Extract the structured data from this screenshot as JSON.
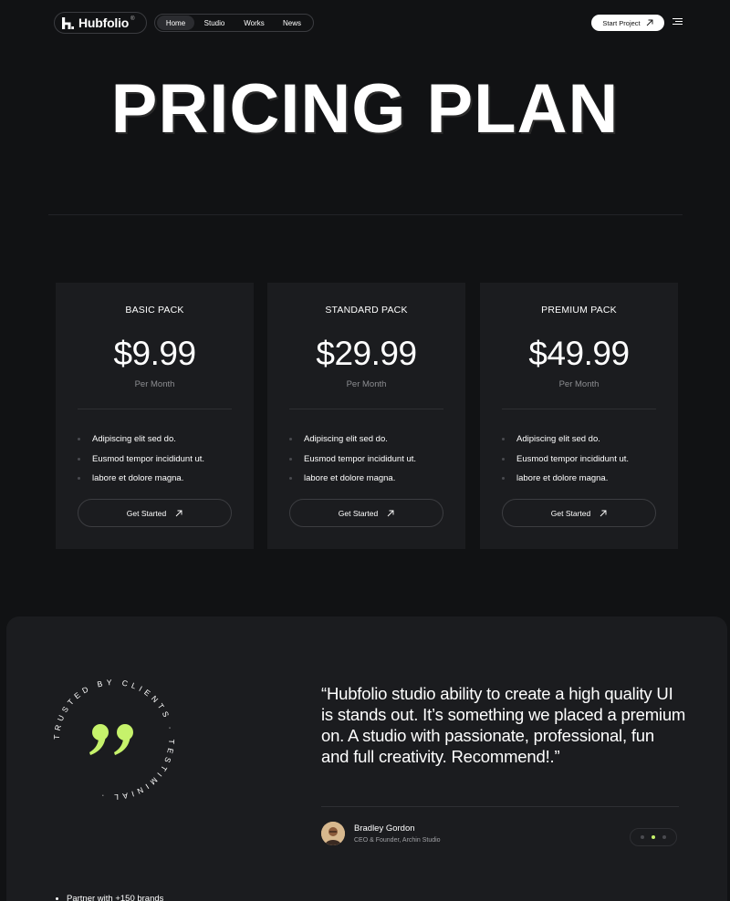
{
  "header": {
    "logo_text": "Hubfolio",
    "logo_reg": "®",
    "nav": [
      "Home",
      "Studio",
      "Works",
      "News"
    ],
    "active_nav": "Home",
    "cta_label": "Start Project"
  },
  "hero": {
    "title": "PRICING PLAN"
  },
  "plans": [
    {
      "name": "BASIC PACK",
      "price": "$9.99",
      "period": "Per Month",
      "features": [
        "Adipiscing elit sed do.",
        "Eusmod tempor incididunt ut.",
        "labore et dolore magna."
      ],
      "button": "Get Started"
    },
    {
      "name": "STANDARD PACK",
      "price": "$29.99",
      "period": "Per Month",
      "features": [
        "Adipiscing elit sed do.",
        "Eusmod tempor incididunt ut.",
        "labore et dolore magna."
      ],
      "button": "Get Started"
    },
    {
      "name": "PREMIUM PACK",
      "price": "$49.99",
      "period": "Per Month",
      "features": [
        "Adipiscing elit sed do.",
        "Eusmod tempor incididunt ut.",
        "labore et dolore magna."
      ],
      "button": "Get Started"
    }
  ],
  "testimonial": {
    "badge_text": "TRUSTED BY CLIENTS · TESTIMINIAL ·",
    "quote": "“Hubfolio studio ability to create a high quality UI is stands out. It’s something we placed a premium on. A studio with passionate, professional, fun and full creativity. Recommend!.”",
    "author_name": "Bradley Gordon",
    "author_role": "CEO & Founder, Archin Studio",
    "accent_color": "#c6f26b",
    "slider_active": 2
  },
  "footer_teaser": {
    "text": "Partner with +150 brands"
  }
}
